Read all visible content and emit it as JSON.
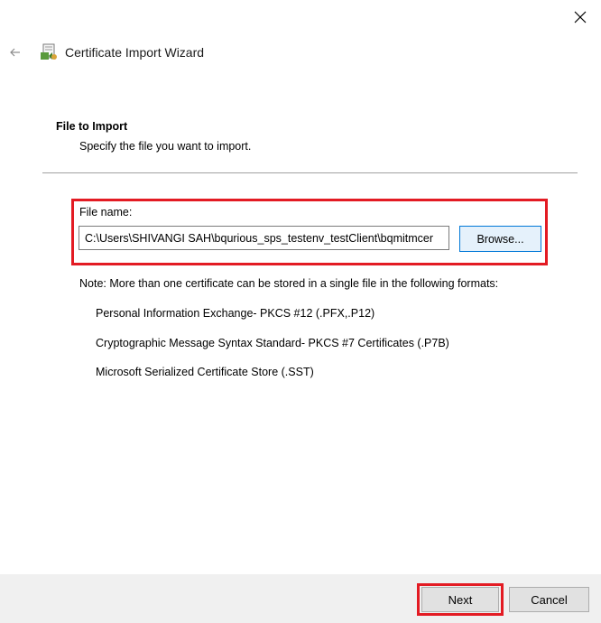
{
  "window": {
    "title": "Certificate Import Wizard",
    "close_icon": "close-icon",
    "back_icon": "back-arrow-icon",
    "title_icon": "certificate-icon"
  },
  "section": {
    "heading": "File to Import",
    "subheading": "Specify the file you want to import."
  },
  "file": {
    "label": "File name:",
    "value": "C:\\Users\\SHIVANGI SAH\\bqurious_sps_testenv_testClient\\bqmitmcer",
    "browse_label": "Browse..."
  },
  "note": {
    "text": "Note:  More than one certificate can be stored in a single file in the following formats:",
    "formats": [
      "Personal Information Exchange- PKCS #12 (.PFX,.P12)",
      "Cryptographic Message Syntax Standard- PKCS #7 Certificates (.P7B)",
      "Microsoft Serialized Certificate Store (.SST)"
    ]
  },
  "footer": {
    "next_label": "Next",
    "cancel_label": "Cancel"
  },
  "colors": {
    "highlight": "#e31b23",
    "browse_border": "#0078d7",
    "footer_bg": "#f0f0f0"
  }
}
